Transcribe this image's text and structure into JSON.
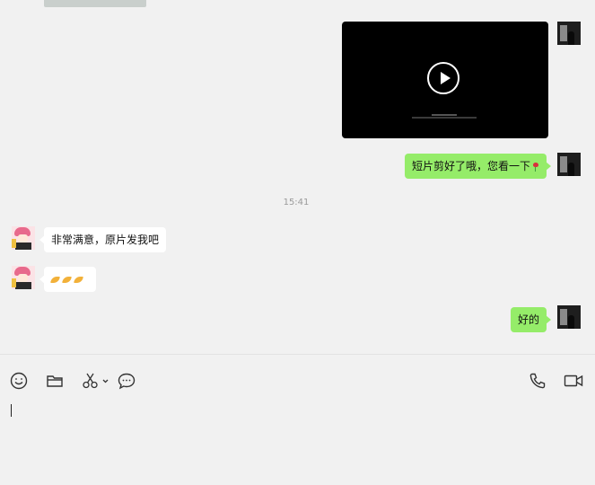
{
  "messages": {
    "video": {
      "type": "video",
      "sender": "self"
    },
    "self_1": {
      "text": "短片剪好了哦，您看一下",
      "emoji": "rose"
    },
    "timestamp": "15:41",
    "peer_1": {
      "text": "非常满意，原片发我吧"
    },
    "peer_2": {
      "emoji": [
        "folded-hands",
        "folded-hands",
        "folded-hands"
      ]
    },
    "self_2": {
      "text": "好的"
    }
  },
  "toolbar": {
    "left": [
      "emoji-icon",
      "folder-icon",
      "scissors-icon",
      "chat-bubble-icon"
    ],
    "right": [
      "phone-icon",
      "video-call-icon"
    ]
  },
  "colors": {
    "outgoing_bubble": "#95ec69",
    "incoming_bubble": "#ffffff",
    "background": "#f1f1f1"
  }
}
